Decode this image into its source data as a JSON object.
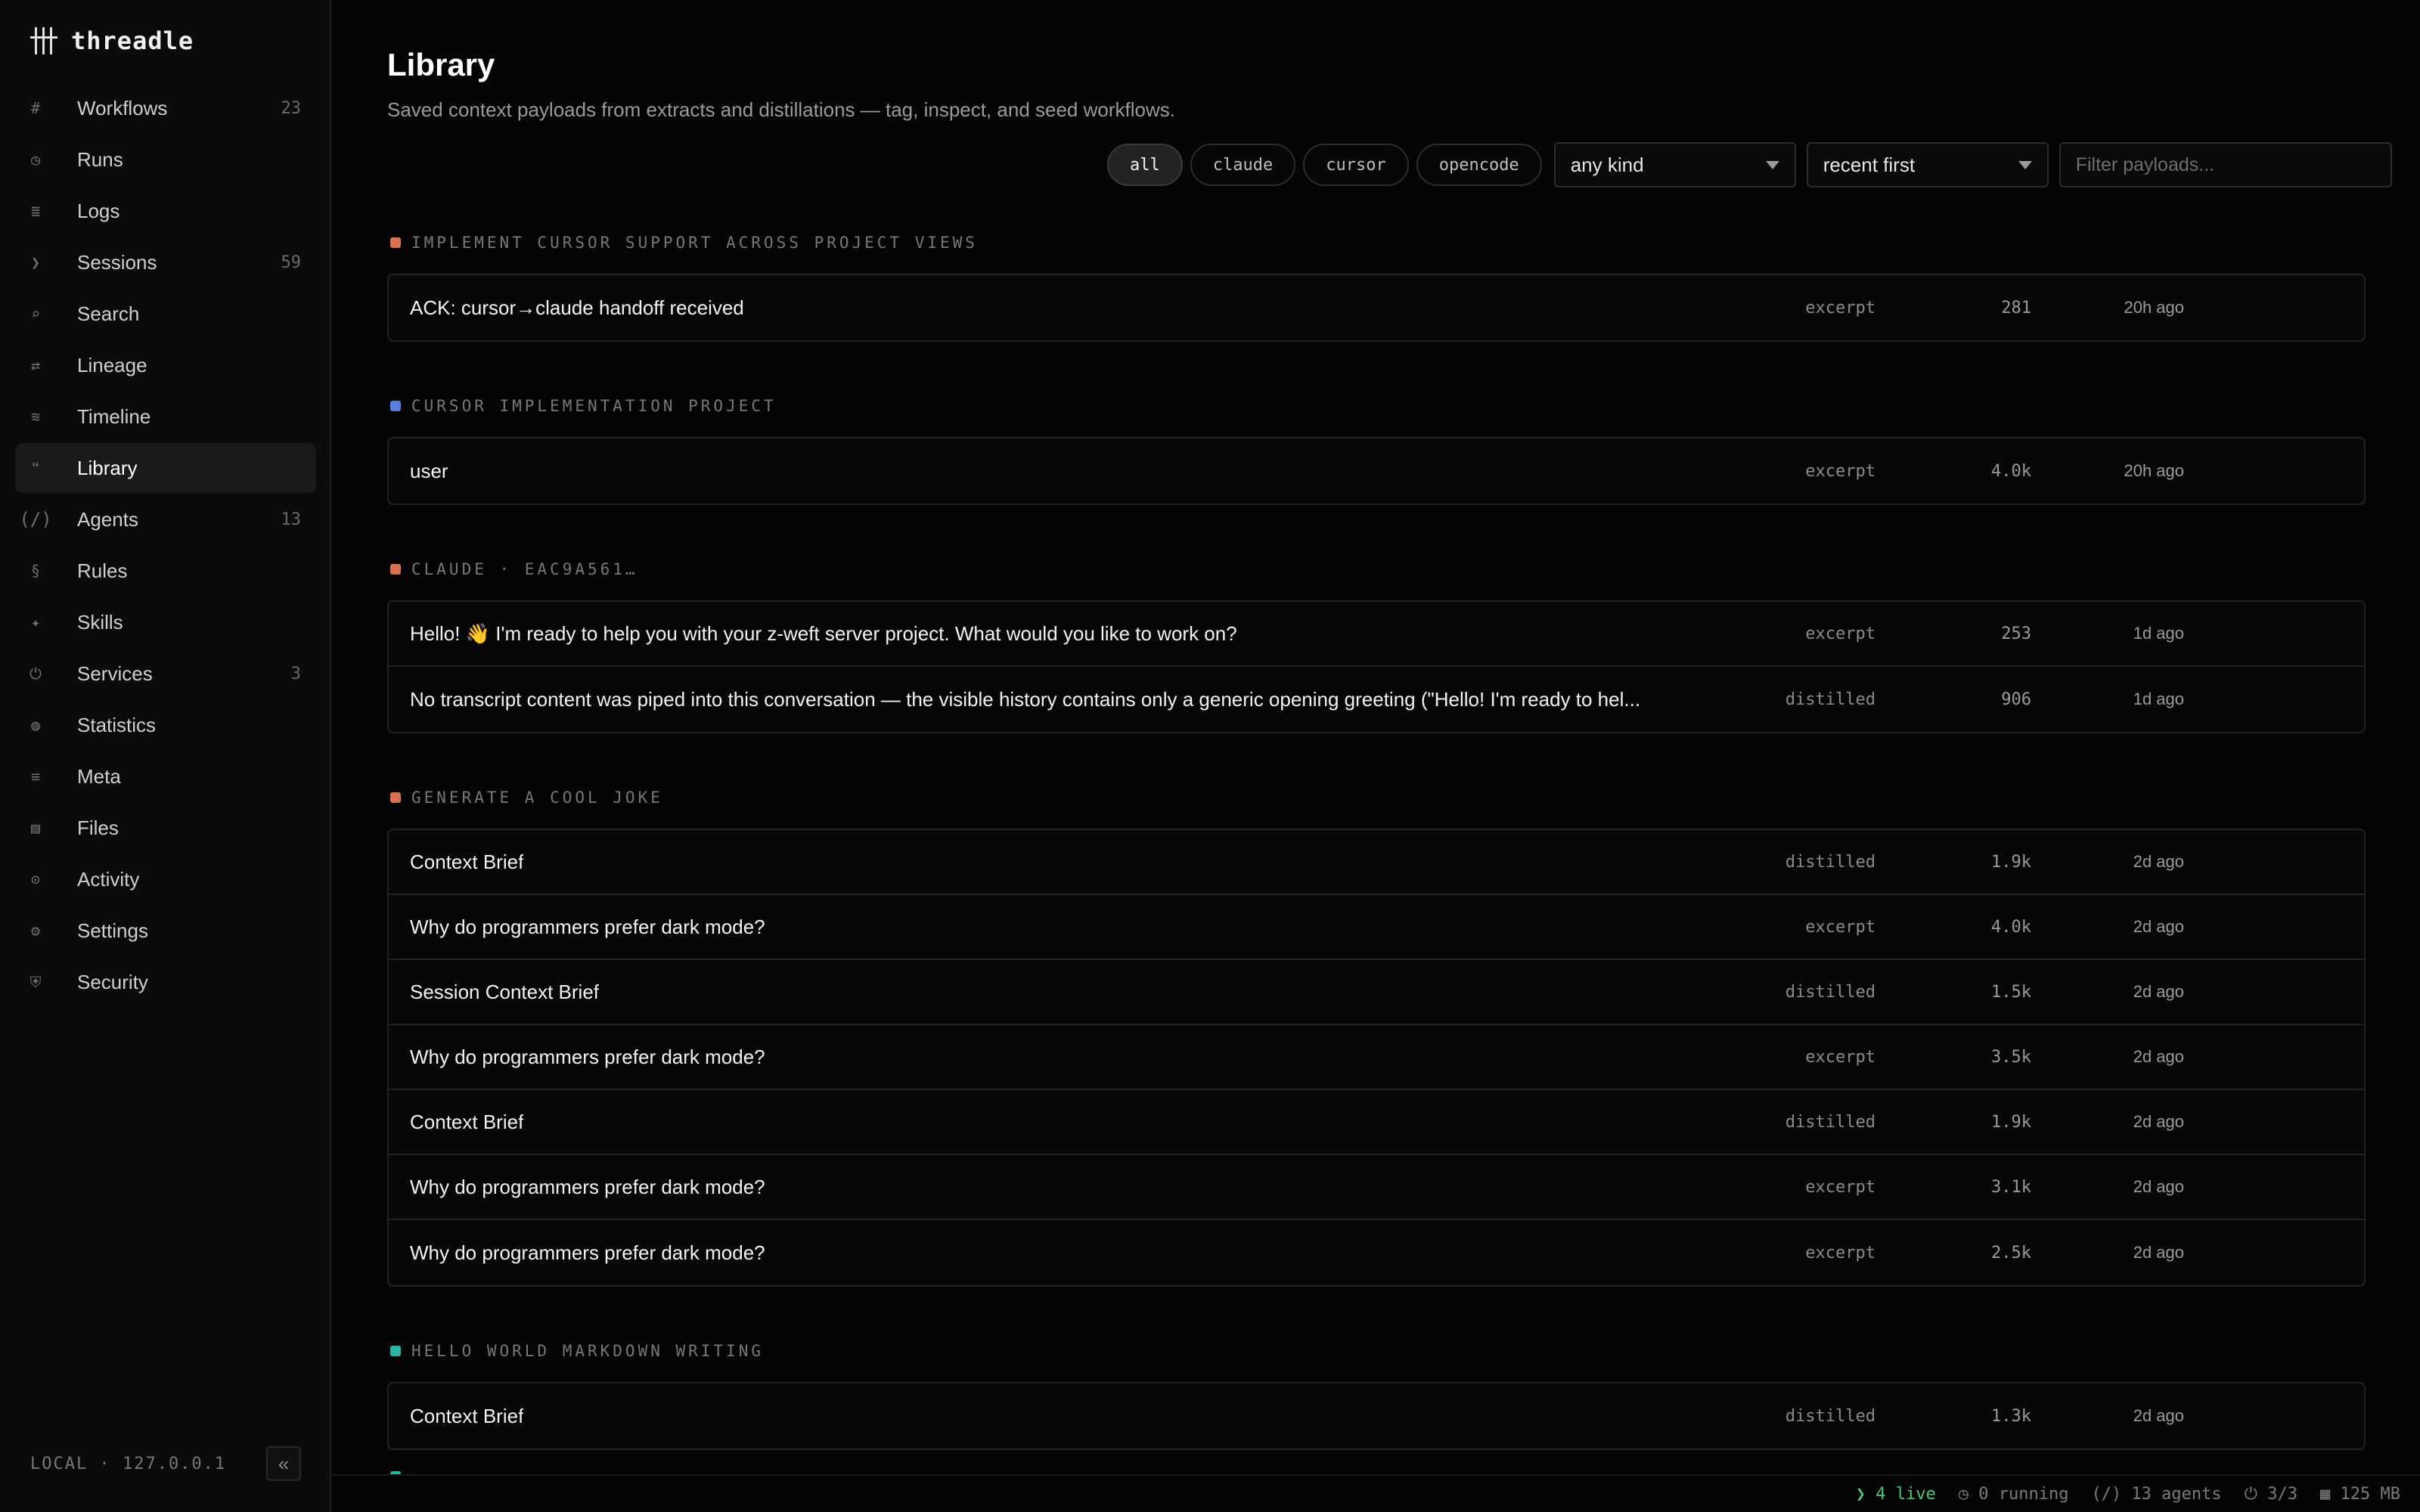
{
  "app": {
    "name": "threadle"
  },
  "sidebar": {
    "items": [
      {
        "label": "Workflows",
        "icon": "#",
        "count": "23"
      },
      {
        "label": "Runs",
        "icon": "◷",
        "count": ""
      },
      {
        "label": "Logs",
        "icon": "≣",
        "count": ""
      },
      {
        "label": "Sessions",
        "icon": "❯",
        "count": "59"
      },
      {
        "label": "Search",
        "icon": "⌕",
        "count": ""
      },
      {
        "label": "Lineage",
        "icon": "⇄",
        "count": ""
      },
      {
        "label": "Timeline",
        "icon": "≋",
        "count": ""
      },
      {
        "label": "Library",
        "icon": "❝",
        "count": "",
        "active": true
      },
      {
        "label": "Agents",
        "icon": "(/)",
        "count": "13"
      },
      {
        "label": "Rules",
        "icon": "§",
        "count": ""
      },
      {
        "label": "Skills",
        "icon": "✦",
        "count": ""
      },
      {
        "label": "Services",
        "icon": "⏻",
        "count": "3"
      },
      {
        "label": "Statistics",
        "icon": "◍",
        "count": ""
      },
      {
        "label": "Meta",
        "icon": "≡",
        "count": ""
      },
      {
        "label": "Files",
        "icon": "▤",
        "count": ""
      },
      {
        "label": "Activity",
        "icon": "⊙",
        "count": ""
      },
      {
        "label": "Settings",
        "icon": "⚙",
        "count": ""
      },
      {
        "label": "Security",
        "icon": "⛨",
        "count": ""
      }
    ],
    "host": "LOCAL · 127.0.0.1",
    "collapse_label": "«"
  },
  "page": {
    "title": "Library",
    "subtitle": "Saved context payloads from extracts and distillations — tag, inspect, and seed workflows."
  },
  "filters": {
    "chips": [
      "all",
      "claude",
      "cursor",
      "opencode"
    ],
    "active_chip": "all",
    "kind_select": "any kind",
    "sort_select": "recent first",
    "search_placeholder": "Filter payloads..."
  },
  "colors": {
    "orange": "#d9704f",
    "blue": "#5b7fe0",
    "teal": "#2bb3a3",
    "live_green": "#4fc27a"
  },
  "groups": [
    {
      "title": "IMPLEMENT CURSOR SUPPORT ACROSS PROJECT VIEWS",
      "color": "#d9704f",
      "rows": [
        {
          "title": "ACK: cursor→claude handoff received",
          "kind": "excerpt",
          "size": "281",
          "time": "20h ago"
        }
      ]
    },
    {
      "title": "CURSOR IMPLEMENTATION PROJECT",
      "color": "#5b7fe0",
      "rows": [
        {
          "title": "user",
          "kind": "excerpt",
          "size": "4.0k",
          "time": "20h ago"
        }
      ]
    },
    {
      "title": "CLAUDE · EAC9A561…",
      "color": "#d9704f",
      "rows": [
        {
          "title": "Hello! 👋 I'm ready to help you with your z-weft server project. What would you like to work on?",
          "kind": "excerpt",
          "size": "253",
          "time": "1d ago"
        },
        {
          "title": "No transcript content was piped into this conversation — the visible history contains only a generic opening greeting (\"Hello! I'm ready to hel...",
          "kind": "distilled",
          "size": "906",
          "time": "1d ago"
        }
      ]
    },
    {
      "title": "GENERATE A COOL JOKE",
      "color": "#d9704f",
      "rows": [
        {
          "title": "Context Brief",
          "kind": "distilled",
          "size": "1.9k",
          "time": "2d ago"
        },
        {
          "title": "Why do programmers prefer dark mode?",
          "kind": "excerpt",
          "size": "4.0k",
          "time": "2d ago"
        },
        {
          "title": "Session Context Brief",
          "kind": "distilled",
          "size": "1.5k",
          "time": "2d ago"
        },
        {
          "title": "Why do programmers prefer dark mode?",
          "kind": "excerpt",
          "size": "3.5k",
          "time": "2d ago"
        },
        {
          "title": "Context Brief",
          "kind": "distilled",
          "size": "1.9k",
          "time": "2d ago"
        },
        {
          "title": "Why do programmers prefer dark mode?",
          "kind": "excerpt",
          "size": "3.1k",
          "time": "2d ago"
        },
        {
          "title": "Why do programmers prefer dark mode?",
          "kind": "excerpt",
          "size": "2.5k",
          "time": "2d ago"
        }
      ]
    },
    {
      "title": "HELLO WORLD MARKDOWN WRITING",
      "color": "#2bb3a3",
      "rows": [
        {
          "title": "Context Brief",
          "kind": "distilled",
          "size": "1.3k",
          "time": "2d ago"
        }
      ]
    }
  ],
  "status": {
    "live": "❯ 4 live",
    "running": "◷ 0 running",
    "agents": "(/) 13 agents",
    "services": "⏻ 3/3",
    "memory": "▦ 125 MB"
  }
}
